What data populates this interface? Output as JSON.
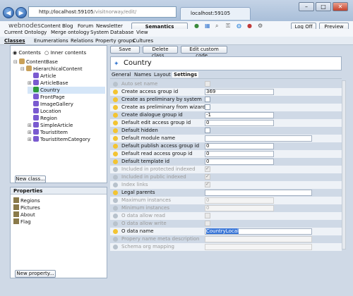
{
  "browser": {
    "url_host": "http://localhost:59105",
    "url_path": "/visitnorway/edit/",
    "tab_title": "localhost:59105"
  },
  "topmenu": {
    "brand": "webnodes",
    "items": [
      "Content",
      "Blog",
      "Forum",
      "Newsletter"
    ],
    "semantics": "Semantics",
    "logoff": "Log Off",
    "preview": "Preview >>"
  },
  "submenu": [
    "Current Ontology",
    "Merge ontology",
    "System",
    "Database",
    "View"
  ],
  "tabs": [
    "Classes",
    "Enumerations",
    "Relations",
    "Property groups",
    "Cultures"
  ],
  "left": {
    "radio_contents": "Contents",
    "radio_inner": "Inner contents",
    "tree": [
      {
        "label": "ContentBase",
        "depth": 0,
        "exp": "−"
      },
      {
        "label": "HierarchicalContent",
        "depth": 1,
        "exp": "−"
      },
      {
        "label": "Article",
        "depth": 2,
        "exp": ""
      },
      {
        "label": "ArticleBase",
        "depth": 2,
        "exp": "+"
      },
      {
        "label": "Country",
        "depth": 2,
        "exp": "",
        "sel": true
      },
      {
        "label": "FrontPage",
        "depth": 2,
        "exp": ""
      },
      {
        "label": "ImageGallery",
        "depth": 2,
        "exp": ""
      },
      {
        "label": "Location",
        "depth": 2,
        "exp": ""
      },
      {
        "label": "Region",
        "depth": 2,
        "exp": ""
      },
      {
        "label": "SimpleArticle",
        "depth": 2,
        "exp": "+"
      },
      {
        "label": "TouristItem",
        "depth": 2,
        "exp": "+"
      },
      {
        "label": "TouristItemCategory",
        "depth": 2,
        "exp": "+"
      }
    ],
    "new_class": "New class...",
    "properties_title": "Properties",
    "properties": [
      "Regions",
      "Pictures",
      "About",
      "Flag"
    ],
    "new_property": "New property..."
  },
  "toolbar": {
    "save": "Save",
    "delete": "Delete class...",
    "edit": "Edit custom code..."
  },
  "class_name": "Country",
  "subtabs": [
    "General",
    "Names",
    "Layout",
    "Settings"
  ],
  "settings": [
    {
      "label": "Auto set name",
      "type": "cb",
      "dis": true
    },
    {
      "label": "Create access group id",
      "type": "text",
      "value": "369"
    },
    {
      "label": "Create as preliminary by system",
      "type": "cb"
    },
    {
      "label": "Create as preliminary from wizard",
      "type": "cb"
    },
    {
      "label": "Create dialogue group id",
      "type": "text",
      "value": "-1"
    },
    {
      "label": "Default edit access group id",
      "type": "text",
      "value": "0"
    },
    {
      "label": "Default hidden",
      "type": "cb"
    },
    {
      "label": "Default module name",
      "type": "wide",
      "value": ""
    },
    {
      "label": "Default publish access group id",
      "type": "text",
      "value": "0"
    },
    {
      "label": "Default read access group id",
      "type": "text",
      "value": "0"
    },
    {
      "label": "Default template id",
      "type": "text",
      "value": "0"
    },
    {
      "label": "Included in protected indexed",
      "type": "cb",
      "dis": true,
      "checked": true
    },
    {
      "label": "Included in public indexed",
      "type": "cb",
      "dis": true,
      "checked": true
    },
    {
      "label": "Index links",
      "type": "cb",
      "dis": true,
      "checked": true
    },
    {
      "label": "Legal parents",
      "type": "wide",
      "value": ""
    },
    {
      "label": "Maximum instances",
      "type": "text",
      "dis": true,
      "value": "0"
    },
    {
      "label": "Minimum instances",
      "type": "text",
      "dis": true,
      "value": "0"
    },
    {
      "label": "O data allow read",
      "type": "cb",
      "dis": true
    },
    {
      "label": "O data allow write",
      "type": "cb",
      "dis": true
    },
    {
      "label": "O data name",
      "type": "wide",
      "value": "CountryLocal",
      "hl": true
    },
    {
      "label": "Propery name meta description",
      "type": "wide",
      "dis": true,
      "value": ""
    },
    {
      "label": "Schema org mapping",
      "type": "wide",
      "dis": true,
      "value": ""
    }
  ],
  "colors": {
    "bulb_on": "#f3c432",
    "bulb_off": "#b8c2cc",
    "selected": "#d5e6f8"
  }
}
